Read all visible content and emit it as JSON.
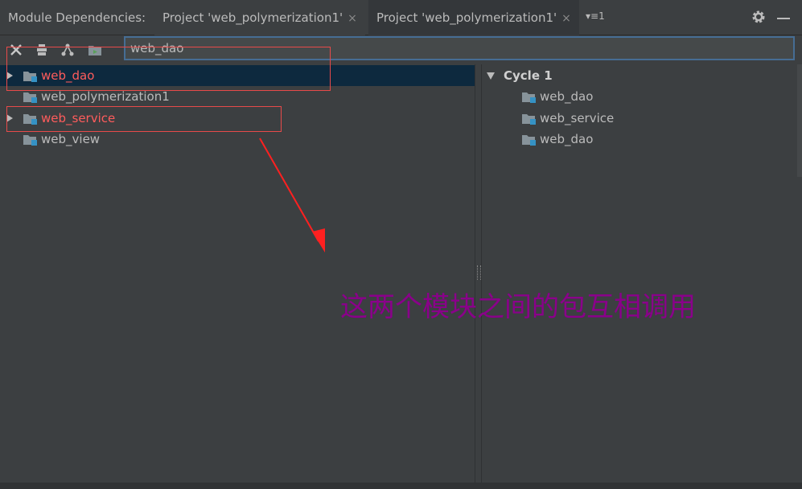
{
  "header": {
    "title": "Module Dependencies:",
    "tabs": [
      {
        "label": "Project 'web_polymerization1'",
        "close": "×"
      },
      {
        "label": "Project 'web_polymerization1'",
        "close": "×"
      }
    ],
    "overflow": "▾≡1"
  },
  "toolbar": {
    "icons": [
      "close-icon",
      "flatten-icon",
      "tree-icon",
      "folder-icon"
    ]
  },
  "search": {
    "value": "web_dao"
  },
  "left_tree": [
    {
      "label": "web_dao",
      "expandable": true,
      "selected": true,
      "cycle": true
    },
    {
      "label": "web_polymerization1",
      "expandable": false,
      "selected": false,
      "cycle": false
    },
    {
      "label": "web_service",
      "expandable": true,
      "selected": false,
      "cycle": true
    },
    {
      "label": "web_view",
      "expandable": false,
      "selected": false,
      "cycle": false
    }
  ],
  "right_tree": {
    "cycle_title": "Cycle 1",
    "items": [
      "web_dao",
      "web_service",
      "web_dao"
    ]
  },
  "annotation": {
    "text": "这两个模块之间的包互相调用",
    "color": "#8a008a",
    "box_color": "#e84a4a"
  },
  "colors": {
    "cycle_text": "#ff5c5c",
    "selection": "#0d293e",
    "search_border": "#466d94"
  }
}
